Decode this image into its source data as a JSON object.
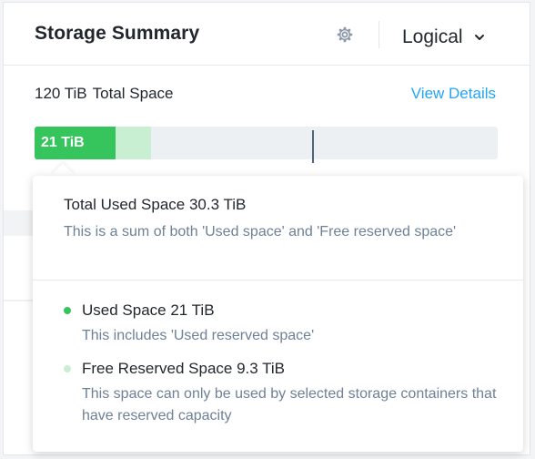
{
  "header": {
    "title": "Storage Summary",
    "settings_icon": "gear-icon",
    "view_select": {
      "value": "Logical",
      "icon": "chevron-down-icon"
    }
  },
  "summary": {
    "total_value": "120 TiB",
    "total_label": "Total Space",
    "view_details": "View Details"
  },
  "bar": {
    "used_label": "21 TiB",
    "total_tib": 120,
    "used_tib": 21,
    "reserved_tib": 9.3,
    "used_fraction": 0.175,
    "reserved_fraction": 0.0775,
    "marker_fraction": 0.6,
    "colors": {
      "used": "#36c45c",
      "reserved": "#c9efd3",
      "track": "#edf0f2",
      "marker": "#51657a"
    }
  },
  "tooltip": {
    "total_used": {
      "heading": "Total Used Space 30.3 TiB",
      "description": "This is a sum of both 'Used space' and 'Free reserved space'"
    },
    "items": [
      {
        "heading": "Used Space 21 TiB",
        "description": "This includes 'Used reserved space'",
        "dot_color": "#36c45c"
      },
      {
        "heading": "Free Reserved Space 9.3 TiB",
        "description": "This space can only be used by selected storage containers that have reserved capacity",
        "dot_color": "#c9efd3"
      }
    ]
  },
  "colors": {
    "accent_link": "#22a5f7",
    "muted_text": "#6e8196"
  }
}
